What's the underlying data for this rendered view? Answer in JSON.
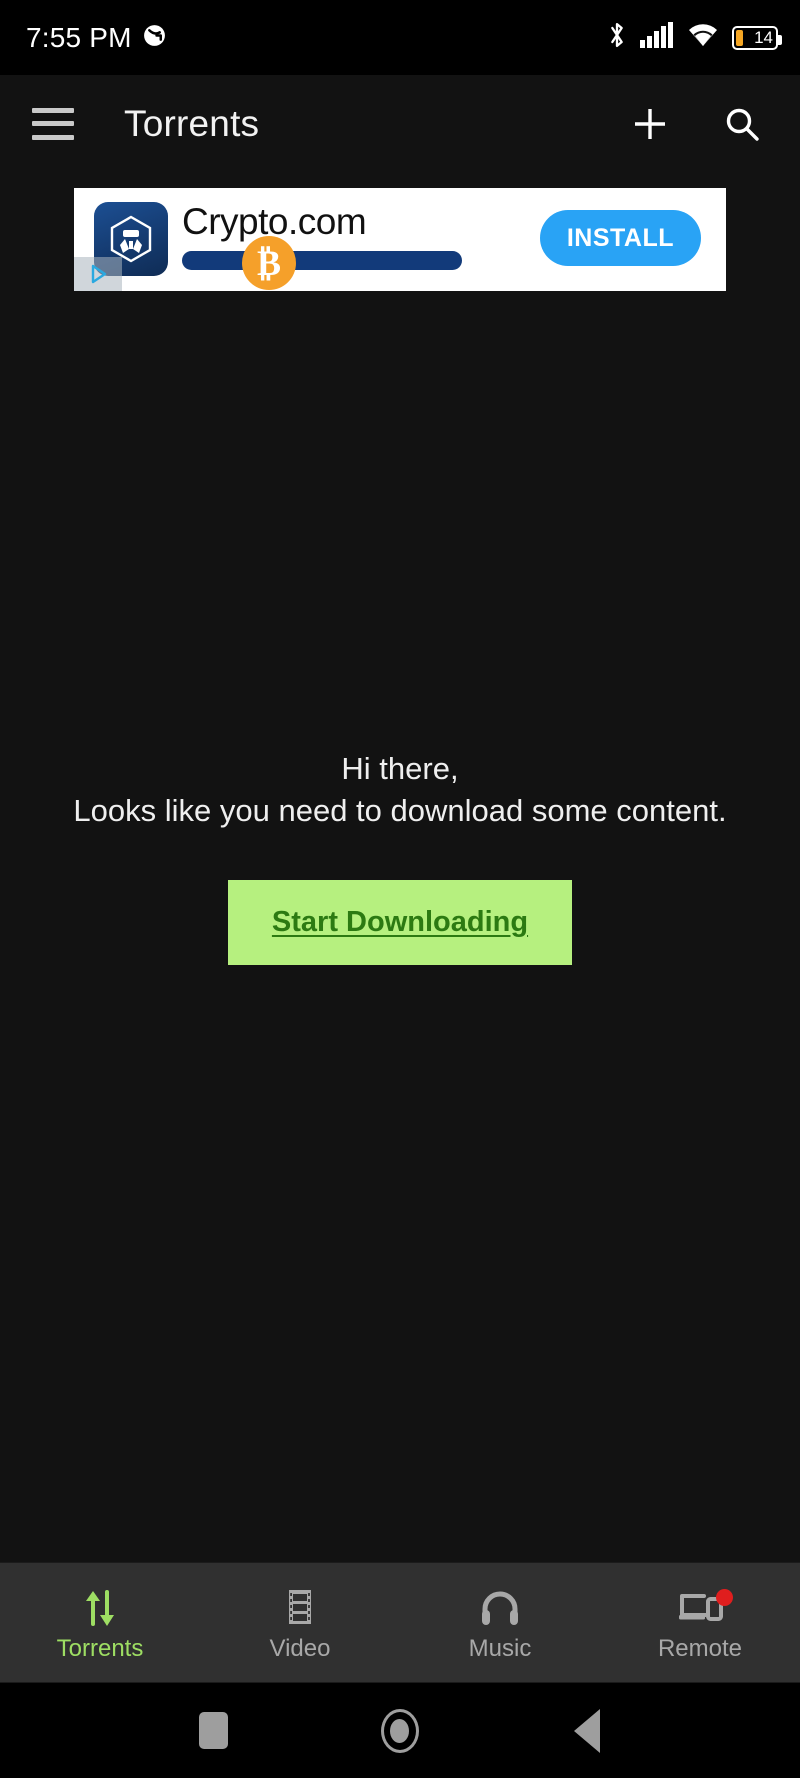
{
  "status_bar": {
    "time": "7:55 PM",
    "notification_icon": "call-forwarding-icon",
    "bluetooth_icon": "bluetooth-icon",
    "signal_icon": "cellular-signal-icon",
    "wifi_icon": "wifi-icon",
    "battery_percent": "14",
    "battery_color": "#f5a623"
  },
  "app_bar": {
    "menu_icon": "hamburger-menu-icon",
    "title": "Torrents",
    "add_icon": "plus-icon",
    "search_icon": "search-icon"
  },
  "ad": {
    "advertiser": "Crypto.com",
    "cta_label": "INSTALL",
    "logo_icon": "crypto-com-logo-icon",
    "coin_icon": "bitcoin-icon",
    "coin_glyph": "₿",
    "adchoices_icon": "ad-choices-icon",
    "cta_color": "#29a3f5",
    "progress_color": "#123a7a"
  },
  "empty_state": {
    "line1": "Hi there,",
    "line2": "Looks like you need to download some content.",
    "button_label": "Start Downloading",
    "button_bg": "#b6f07f",
    "button_text_color": "#2c7a12"
  },
  "bottom_nav": {
    "active_color": "#9ede63",
    "inactive_color": "#a8a8a8",
    "badge_color": "#e01e1e",
    "items": [
      {
        "label": "Torrents",
        "icon": "transfer-arrows-icon",
        "active": true,
        "badge": false
      },
      {
        "label": "Video",
        "icon": "film-strip-icon",
        "active": false,
        "badge": false
      },
      {
        "label": "Music",
        "icon": "headphones-icon",
        "active": false,
        "badge": false
      },
      {
        "label": "Remote",
        "icon": "remote-devices-icon",
        "active": false,
        "badge": true
      }
    ]
  },
  "android_nav": {
    "recents_icon": "square-recents-icon",
    "home_icon": "circle-home-icon",
    "back_icon": "triangle-back-icon"
  }
}
